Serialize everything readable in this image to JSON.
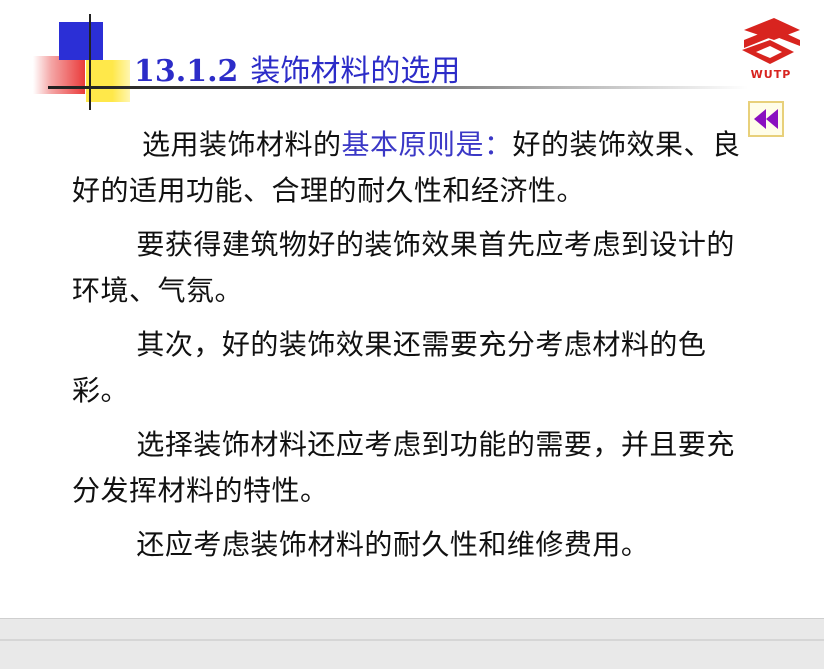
{
  "slide": {
    "title_number": "13.1.2",
    "title_text": "装饰材料的选用",
    "logo_text": "WUTP",
    "paragraphs": [
      {
        "lead": "选用装饰材料的",
        "highlight": "基本原则是：",
        "rest": "好的装饰效果、良好的适用功能、合理的耐久性和经济性。"
      },
      {
        "text": "要获得建筑物好的装饰效果首先应考虑到设计的环境、气氛。"
      },
      {
        "text": "其次，好的装饰效果还需要充分考虑材料的色彩。"
      },
      {
        "text": "选择装饰材料还应考虑到功能的需要，并且要充分发挥材料的特性。"
      },
      {
        "text": "还应考虑装饰材料的耐久性和维修费用。"
      }
    ]
  },
  "icons": {
    "back_button": "rewind-double-left-icon",
    "logo": "wutp-logo-icon"
  },
  "colors": {
    "title": "#2c2cc8",
    "highlight": "#3b38c6",
    "back_arrow": "#8a10c0",
    "logo": "#d8241f"
  }
}
